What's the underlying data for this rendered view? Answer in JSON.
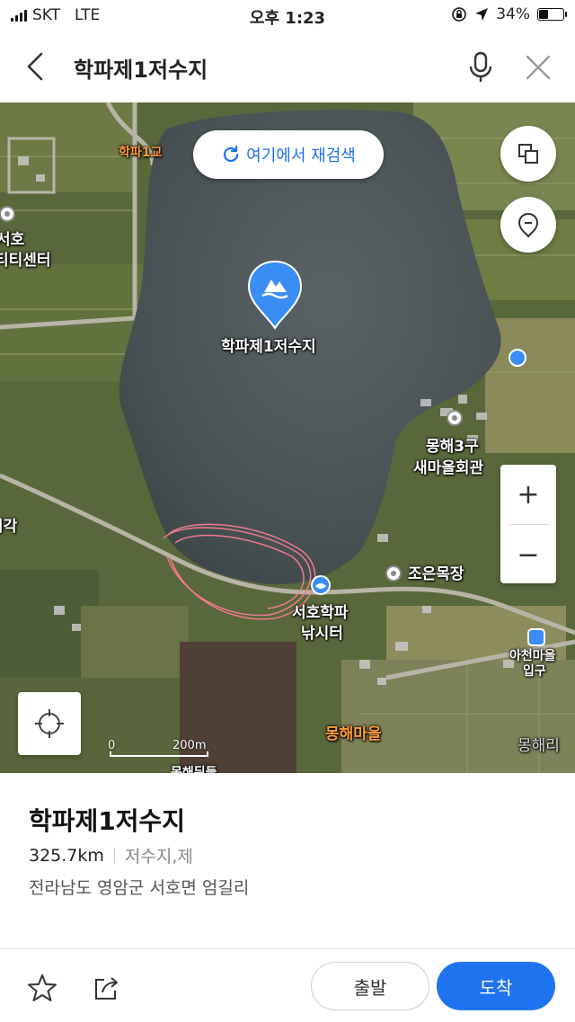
{
  "status_bar": {
    "carrier": "SKT",
    "network": "LTE",
    "time": "오후 1:23",
    "battery": "34%",
    "battery_level": 0.34
  },
  "header": {
    "search_query": "학파제1저수지",
    "back_icon": "chevron-left-icon",
    "mic_icon": "microphone-icon",
    "close_icon": "close-icon"
  },
  "map": {
    "research_button": "여기에서 재검색",
    "marker_label": "학파제1저수지",
    "labels": {
      "bridge": "학파1교",
      "community_left_1": "서호",
      "community_left_2": "티티센터",
      "village_hall_1": "몽해3구",
      "village_hall_2": "새마을회관",
      "ranch": "조은목장",
      "fishing_1": "서호학파",
      "fishing_2": "낚시터",
      "bus_stop_1": "아천마을",
      "bus_stop_2": "입구",
      "village": "몽해마을",
      "village_right": "몽해리",
      "left_edge": "시각",
      "bottom_cut": "몽해뒤들"
    },
    "scale": {
      "start": "0",
      "end": "200m"
    },
    "zoom_in": "+",
    "zoom_out": "−"
  },
  "place": {
    "name": "학파제1저수지",
    "distance": "325.7km",
    "category": "저수지,제",
    "address": "전라남도 영암군 서호면 엄길리"
  },
  "actions": {
    "start": "출발",
    "arrive": "도착"
  },
  "colors": {
    "accent": "#1f73f0",
    "marker": "#3a8df5",
    "water": "#4a5558"
  }
}
